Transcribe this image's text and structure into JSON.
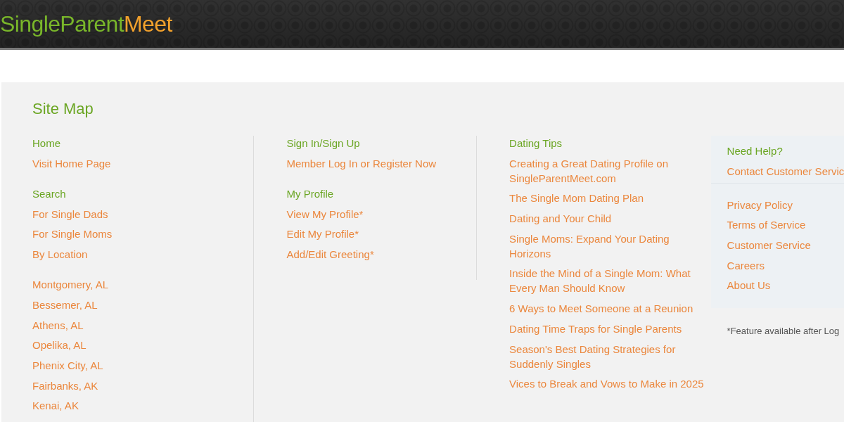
{
  "header": {
    "logo": {
      "part_1": "SingleParent",
      "part_2": "Meet"
    }
  },
  "site_map": {
    "title": "Site Map",
    "columns": [
      {
        "groups": [
          {
            "heading": "Home",
            "links": [
              "Visit Home Page"
            ]
          },
          {
            "heading": "Search",
            "links": [
              "For Single Dads",
              "For Single Moms",
              "By Location"
            ]
          },
          {
            "links": [
              "Montgomery, AL",
              "Bessemer, AL",
              "Athens, AL",
              "Opelika, AL",
              "Phenix City, AL",
              "Fairbanks, AK",
              "Kenai, AK"
            ]
          }
        ]
      },
      {
        "groups": [
          {
            "heading": "Sign In/Sign Up",
            "links": [
              "Member Log In or Register Now"
            ]
          },
          {
            "heading": "My Profile",
            "links": [
              "View My Profile*",
              "Edit My Profile*",
              "Add/Edit Greeting*"
            ]
          }
        ]
      },
      {
        "groups": [
          {
            "heading": "Dating Tips",
            "links": [
              "Creating a Great Dating Profile on SingleParentMeet.com",
              "The Single Mom Dating Plan",
              "Dating and Your Child",
              "Single Moms: Expand Your Dating Horizons",
              "Inside the Mind of a Single Mom: What Every Man Should Know",
              "6 Ways to Meet Someone at a Reunion",
              "Dating Time Traps for Single Parents",
              "Season's Best Dating Strategies for Suddenly Singles",
              "Vices to Break and Vows to Make in 2025"
            ]
          }
        ]
      }
    ],
    "help_panel": {
      "heading": "Need Help?",
      "links": [
        "Contact Customer Servic"
      ],
      "footer_links": [
        "Privacy Policy",
        "Terms of Service",
        "Customer Service",
        "Careers",
        "About Us"
      ]
    },
    "footnote": "*Feature available after Log"
  }
}
